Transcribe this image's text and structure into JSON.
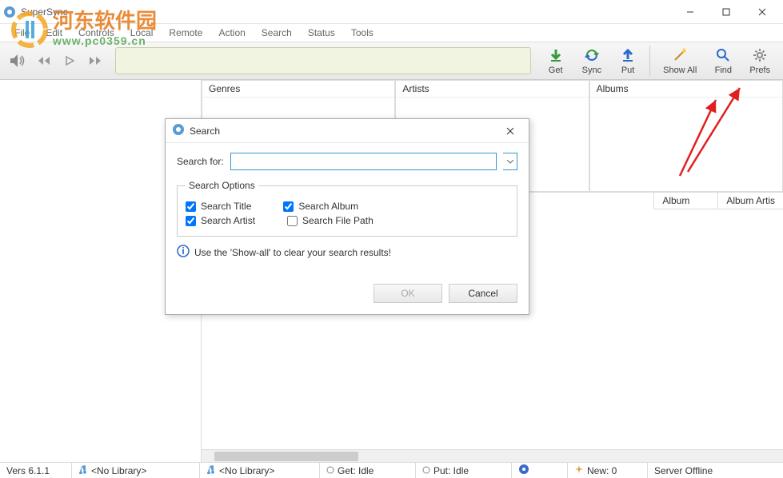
{
  "window": {
    "title": "SuperSync"
  },
  "menubar": [
    "File",
    "Edit",
    "Controls",
    "Local",
    "Remote",
    "Action",
    "Search",
    "Status",
    "Tools"
  ],
  "toolbar": {
    "actions": {
      "get": "Get",
      "sync": "Sync",
      "put": "Put",
      "showall": "Show All",
      "find": "Find",
      "prefs": "Prefs"
    }
  },
  "panels": {
    "genres": "Genres",
    "artists": "Artists",
    "albums": "Albums"
  },
  "table": {
    "col_album": "Album",
    "col_album_artist": "Album Artis"
  },
  "dialog": {
    "title": "Search",
    "search_label": "Search for:",
    "options_legend": "Search Options",
    "opt_title": "Search Title",
    "opt_album": "Search Album",
    "opt_artist": "Search Artist",
    "opt_filepath": "Search File Path",
    "info": "Use the 'Show-all' to clear your search results!",
    "ok": "OK",
    "cancel": "Cancel",
    "checked": {
      "title": true,
      "album": true,
      "artist": true,
      "filepath": false
    }
  },
  "statusbar": {
    "version": "Vers 6.1.1",
    "lib_local": "<No Library>",
    "lib_remote": "<No Library>",
    "get_status": "Get: Idle",
    "put_status": "Put: Idle",
    "new_count": "New: 0",
    "server": "Server Offline"
  },
  "watermark": {
    "text": "河东软件园",
    "url": "www.pc0359.cn"
  }
}
